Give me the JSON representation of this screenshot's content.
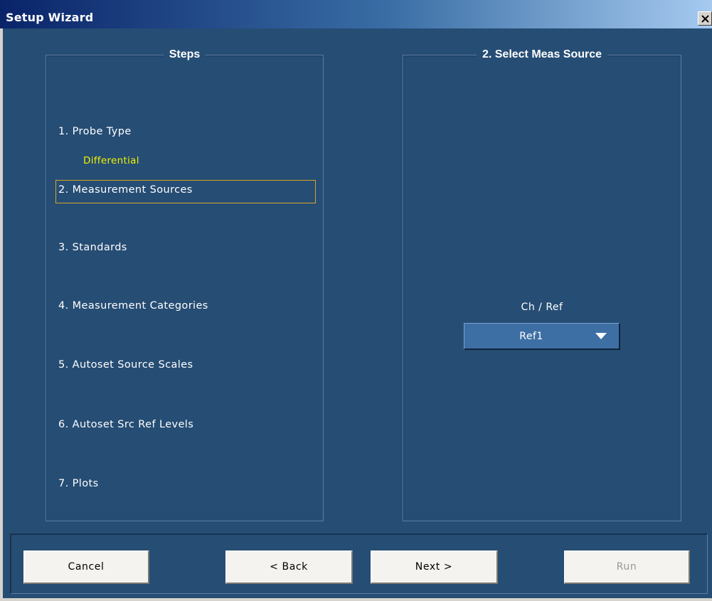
{
  "window": {
    "title": "Setup Wizard"
  },
  "steps": {
    "legend": "Steps",
    "items": [
      "1. Probe Type",
      "2. Measurement Sources",
      "3. Standards",
      "4. Measurement Categories",
      "5. Autoset Source Scales",
      "6. Autoset Src Ref Levels",
      "7. Plots"
    ],
    "probe_type_value": "Differential",
    "active_index": 1
  },
  "source_panel": {
    "legend": "2. Select Meas Source",
    "ch_ref_label": "Ch  /  Ref",
    "selected_source": "Ref1"
  },
  "buttons": {
    "cancel": "Cancel",
    "back": "< Back",
    "next": "Next >",
    "run": "Run",
    "run_enabled": false
  },
  "colors": {
    "panel_background": "#264d74",
    "highlight_text": "#f2f200",
    "active_step_border": "#d6a52a"
  },
  "icons": {
    "close": "close-icon",
    "dropdown": "chevron-down-icon"
  }
}
